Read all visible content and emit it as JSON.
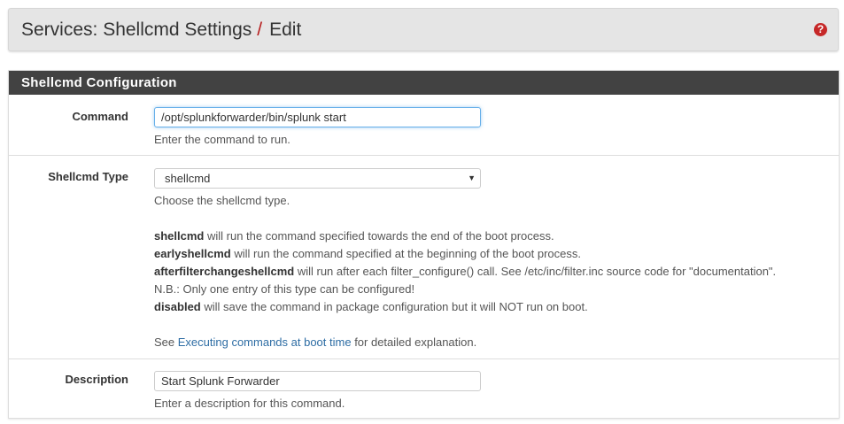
{
  "header": {
    "crumb_main": "Services: Shellcmd Settings",
    "separator": "/",
    "crumb_current": "Edit",
    "help_icon": "question-circle-icon"
  },
  "panel": {
    "title": "Shellcmd Configuration"
  },
  "command": {
    "label": "Command",
    "value": "/opt/splunkforwarder/bin/splunk start",
    "help": "Enter the command to run."
  },
  "type": {
    "label": "Shellcmd Type",
    "selected": "shellcmd",
    "help": "Choose the shellcmd type.",
    "lines": [
      {
        "term": "shellcmd",
        "text": " will run the command specified towards the end of the boot process."
      },
      {
        "term": "earlyshellcmd",
        "text": " will run the command specified at the beginning of the boot process."
      },
      {
        "term": "afterfilterchangeshellcmd",
        "text": " will run after each filter_configure() call. See /etc/inc/filter.inc source code for \"documentation\"."
      },
      {
        "term": "",
        "text": "N.B.: Only one entry of this type can be configured!"
      },
      {
        "term": "disabled",
        "text": " will save the command in package configuration but it will NOT run on boot."
      }
    ],
    "see_prefix": "See ",
    "see_link": "Executing commands at boot time",
    "see_suffix": " for detailed explanation."
  },
  "description": {
    "label": "Description",
    "value": "Start Splunk Forwarder",
    "help": "Enter a description for this command."
  }
}
